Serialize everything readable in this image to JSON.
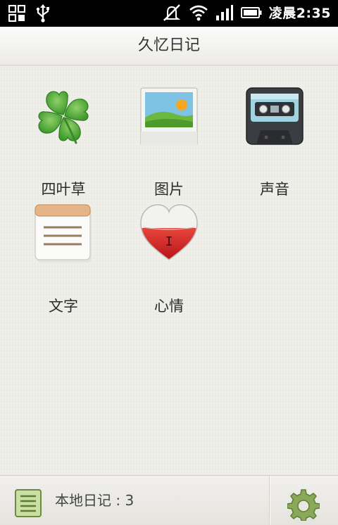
{
  "status_bar": {
    "time": "凌晨2:35",
    "icons": [
      "grid-icon",
      "usb-icon",
      "silent-icon",
      "wifi-icon",
      "signal-icon",
      "battery-icon"
    ]
  },
  "app": {
    "title": "久忆日记"
  },
  "tiles": [
    {
      "label": "四叶草",
      "icon": "clover-icon"
    },
    {
      "label": "图片",
      "icon": "picture-icon"
    },
    {
      "label": "声音",
      "icon": "cassette-icon"
    },
    {
      "label": "文字",
      "icon": "notepad-icon"
    },
    {
      "label": "心情",
      "icon": "heart-icon"
    }
  ],
  "bottom_bar": {
    "count_label": "本地日记",
    "separator": ":",
    "count": "3",
    "icons": [
      "list-icon",
      "gear-icon"
    ]
  },
  "colors": {
    "status_bar": "#000000",
    "accent_green": "#5aa33c",
    "heart_red": "#d8262b"
  }
}
